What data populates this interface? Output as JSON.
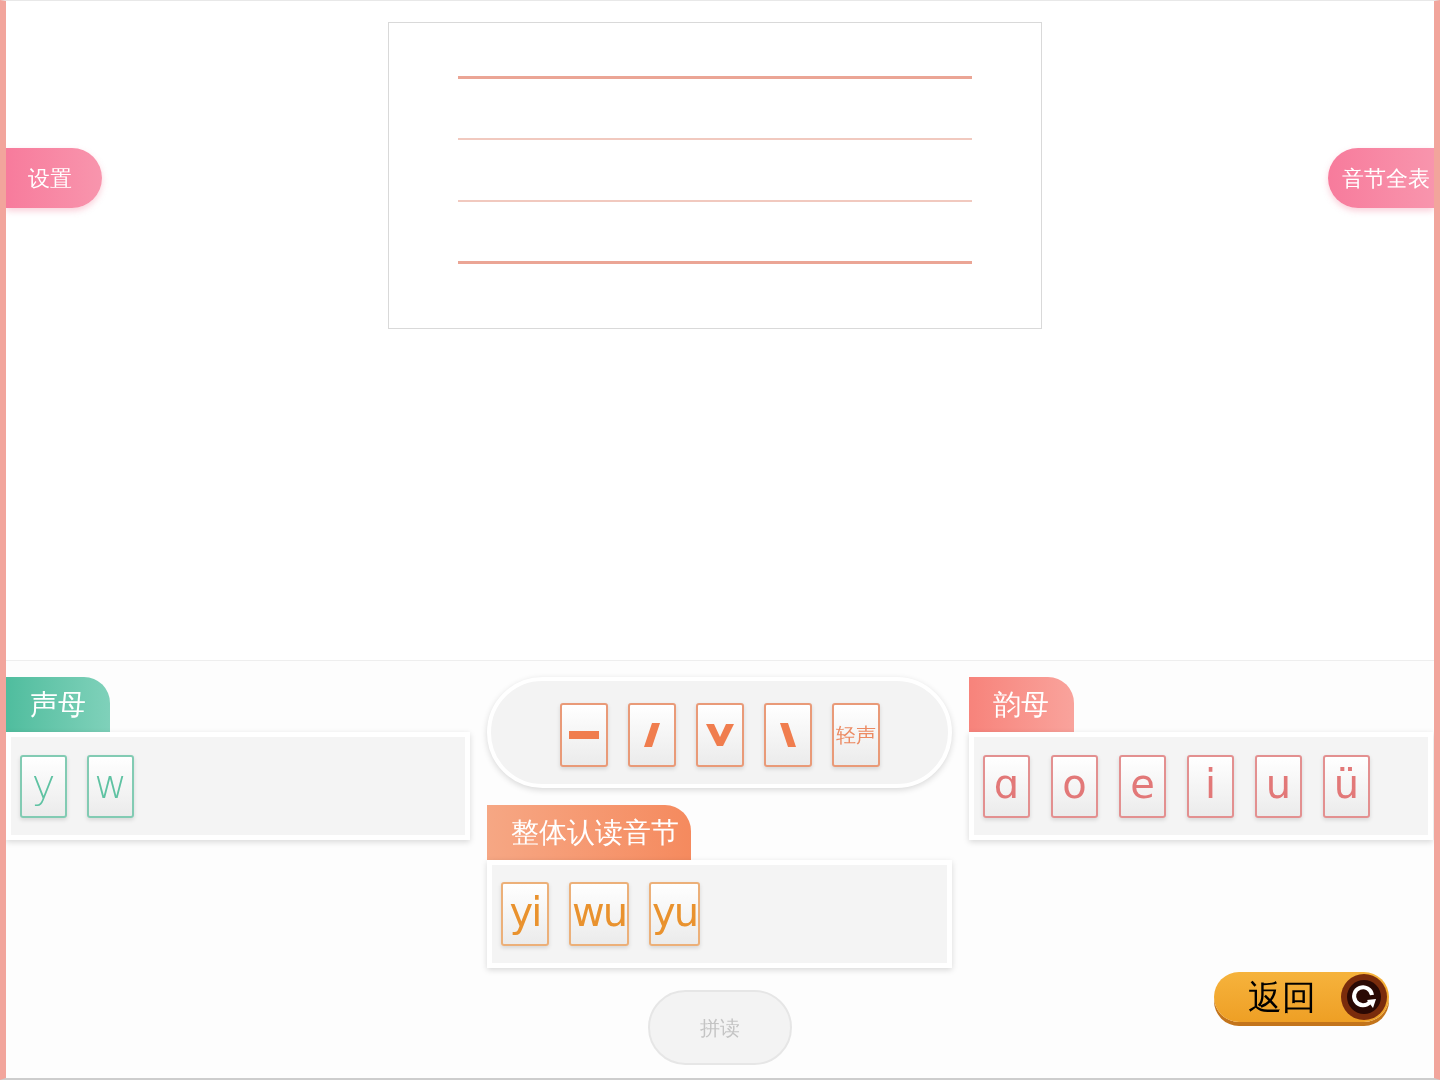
{
  "settings_button": {
    "label": "设置"
  },
  "syllable_table_button": {
    "label": "音节全表"
  },
  "initials": {
    "title": "声母",
    "letters": [
      "y",
      "w"
    ]
  },
  "tones": {
    "marks": [
      {
        "kind": "flat"
      },
      {
        "kind": "rising"
      },
      {
        "kind": "dipping"
      },
      {
        "kind": "falling"
      },
      {
        "kind": "neutral",
        "label": "轻声"
      }
    ]
  },
  "whole_syllables": {
    "title": "整体认读音节",
    "syllables": [
      "yi",
      "wu",
      "yu"
    ]
  },
  "finals": {
    "title": "韵母",
    "letters": [
      "ɑ",
      "o",
      "e",
      "i",
      "u",
      "ü"
    ]
  },
  "spell_button": {
    "label": "拼读",
    "disabled": true
  },
  "back_button": {
    "label": "返回"
  }
}
